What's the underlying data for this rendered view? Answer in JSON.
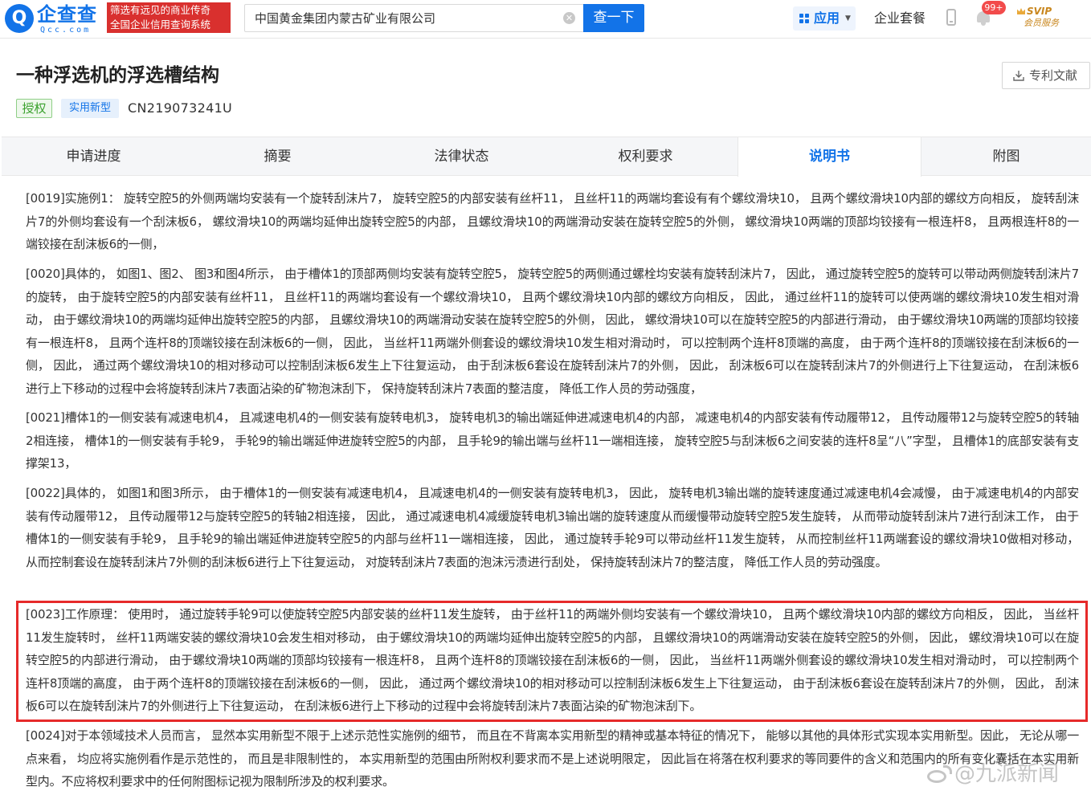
{
  "topbar": {
    "logo": {
      "mark": "Q",
      "name": "企查查",
      "domain": "Qcc.com"
    },
    "slogan": [
      "筛选有远见的商业传奇",
      "全国企业信用查询系统"
    ],
    "search": {
      "value": "中国黄金集团内蒙古矿业有限公司",
      "placeholder": "",
      "button_label": "查一下"
    },
    "app_menu_label": "应用",
    "suite_label": "企业套餐",
    "notification_badge": "99+",
    "svip": {
      "top": "SVIP",
      "bottom": "会员服务"
    },
    "icons": [
      "clear-icon",
      "grid-icon",
      "phone-icon",
      "bell-icon",
      "crown-icon"
    ]
  },
  "patent": {
    "title": "一种浮选机的浮选槽结构",
    "status_tag": "授权",
    "type_tag": "实用新型",
    "number": "CN219073241U",
    "download_label": "专利文献"
  },
  "tabs": [
    {
      "label": "申请进度",
      "active": false
    },
    {
      "label": "摘要",
      "active": false
    },
    {
      "label": "法律状态",
      "active": false
    },
    {
      "label": "权利要求",
      "active": false
    },
    {
      "label": "说明书",
      "active": true
    },
    {
      "label": "附图",
      "active": false
    }
  ],
  "paragraphs": [
    "[0019]实施例1：  旋转空腔5的外侧两端均安装有一个旋转刮沫片7，  旋转空腔5的内部安装有丝杆11，  且丝杆11的两端均套设有有个螺纹滑块10，  且两个螺纹滑块10内部的螺纹方向相反，  旋转刮沫片7的外侧均套设有一个刮沫板6，  螺纹滑块10的两端均延伸出旋转空腔5的内部，  且螺纹滑块10的两端滑动安装在旋转空腔5的外侧，  螺纹滑块10两端的顶部均铰接有一根连杆8，  且两根连杆8的一端铰接在刮沫板6的一侧，",
    "[0020]具体的，  如图1、图2、  图3和图4所示，  由于槽体1的顶部两侧均安装有旋转空腔5，  旋转空腔5的两侧通过螺栓均安装有旋转刮沫片7，  因此，  通过旋转空腔5的旋转可以带动两侧旋转刮沫片7的旋转，  由于旋转空腔5的内部安装有丝杆11，  且丝杆11的两端均套设有一个螺纹滑块10，  且两个螺纹滑块10内部的螺纹方向相反，  因此，  通过丝杆11的旋转可以使两端的螺纹滑块10发生相对滑动，  由于螺纹滑块10的两端均延伸出旋转空腔5的内部，  且螺纹滑块10的两端滑动安装在旋转空腔5的外侧，  因此，  螺纹滑块10可以在旋转空腔5的内部进行滑动，  由于螺纹滑块10两端的顶部均铰接有一根连杆8，  且两个连杆8的顶端铰接在刮沫板6的一侧，  因此，  当丝杆11两端外侧套设的螺纹滑块10发生相对滑动时，  可以控制两个连杆8顶端的高度，  由于两个连杆8的顶端铰接在刮沫板6的一侧，  因此，  通过两个螺纹滑块10的相对移动可以控制刮沫板6发生上下往复运动，  由于刮沫板6套设在旋转刮沫片7的外侧，  因此，  刮沫板6可以在旋转刮沫片7的外侧进行上下往复运动，  在刮沫板6进行上下移动的过程中会将旋转刮沫片7表面沾染的矿物泡沫刮下，  保持旋转刮沫片7表面的整洁度，  降低工作人员的劳动强度，",
    "[0021]槽体1的一侧安装有减速电机4，  且减速电机4的一侧安装有旋转电机3，  旋转电机3的输出端延伸进减速电机4的内部，  减速电机4的内部安装有传动履带12，  且传动履带12与旋转空腔5的转轴2相连接，  槽体1的一侧安装有手轮9，  手轮9的输出端延伸进旋转空腔5的内部，  且手轮9的输出端与丝杆11一端相连接，  旋转空腔5与刮沫板6之间安装的连杆8呈“八”字型，  且槽体1的底部安装有支撑架13，",
    "[0022]具体的，  如图1和图3所示，  由于槽体1的一侧安装有减速电机4，  且减速电机4的一侧安装有旋转电机3，  因此，  旋转电机3输出端的旋转速度通过减速电机4会减慢，  由于减速电机4的内部安装有传动履带12，  且传动履带12与旋转空腔5的转轴2相连接，  因此，  通过减速电机4减缓旋转电机3输出端的旋转速度从而缓慢带动旋转空腔5发生旋转，  从而带动旋转刮沫片7进行刮沫工作，  由于槽体1的一侧安装有手轮9，  且手轮9的输出端延伸进旋转空腔5的内部与丝杆11一端相连接，  因此，  通过旋转手轮9可以带动丝杆11发生旋转，  从而控制丝杆11两端套设的螺纹滑块10做相对移动，  从而控制套设在旋转刮沫片7外侧的刮沫板6进行上下往复运动，  对旋转刮沫片7表面的泡沫污渍进行刮处，  保持旋转刮沫片7的整洁度，  降低工作人员的劳动强度。",
    "[0023]工作原理：  使用时，  通过旋转手轮9可以使旋转空腔5内部安装的丝杆11发生旋转，  由于丝杆11的两端外侧均安装有一个螺纹滑块10，  且两个螺纹滑块10内部的螺纹方向相反，  因此，  当丝杆11发生旋转时，  丝杆11两端安装的螺纹滑块10会发生相对移动，  由于螺纹滑块10的两端均延伸出旋转空腔5的内部，  且螺纹滑块10的两端滑动安装在旋转空腔5的外侧，  因此，  螺纹滑块10可以在旋转空腔5的内部进行滑动，  由于螺纹滑块10两端的顶部均铰接有一根连杆8，  且两个连杆8的顶端铰接在刮沫板6的一侧，  因此，  当丝杆11两端外侧套设的螺纹滑块10发生相对滑动时，  可以控制两个连杆8顶端的高度，  由于两个连杆8的顶端铰接在刮沫板6的一侧，  因此，  通过两个螺纹滑块10的相对移动可以控制刮沫板6发生上下往复运动，  由于刮沫板6套设在旋转刮沫片7的外侧，  因此，  刮沫板6可以在旋转刮沫片7的外侧进行上下往复运动，  在刮沫板6进行上下移动的过程中会将旋转刮沫片7表面沾染的矿物泡沫刮下。",
    "[0024]对于本领域技术人员而言，  显然本实用新型不限于上述示范性实施例的细节，  而且在不背离本实用新型的精神或基本特征的情况下，  能够以其他的具体形式实现本实用新型。因此，  无论从哪一点来看，  均应将实施例看作是示范性的，  而且是非限制性的，  本实用新型的范围由所附权利要求而不是上述说明限定，  因此旨在将落在权利要求的等同要件的含义和范围内的所有变化囊括在本实用新型内。不应将权利要求中的任何附图标记视为限制所涉及的权利要求。"
  ],
  "watermark": "@九派新闻",
  "colors": {
    "brand": "#1273e8",
    "slogan_bg": "#d9302e",
    "highlight": "#e62a2a",
    "badge": "#f24b4b",
    "granted": "#3aa12d"
  }
}
